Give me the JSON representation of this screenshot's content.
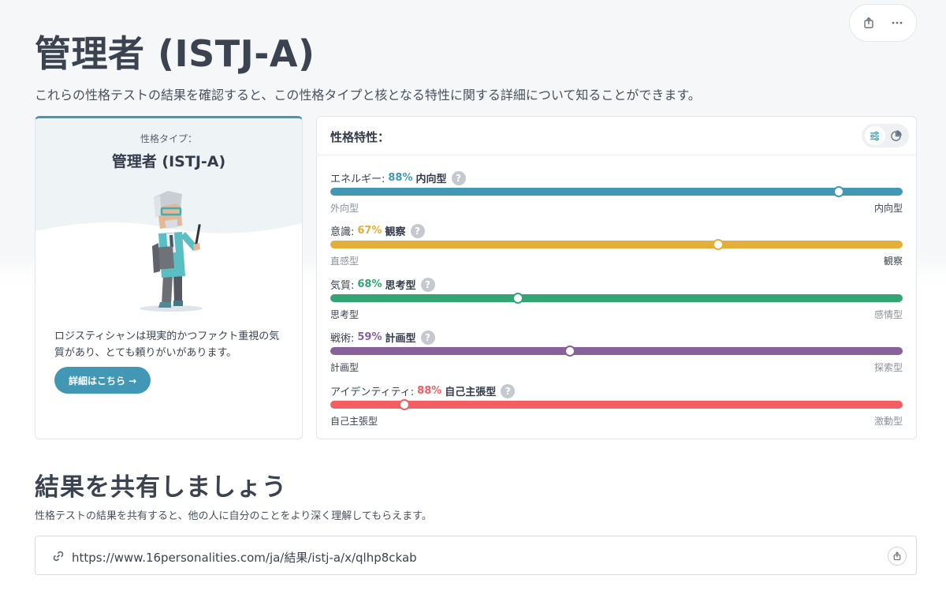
{
  "header": {
    "title": "管理者 (ISTJ-A)",
    "subtitle": "これらの性格テストの結果を確認すると、この性格タイプと核となる特性に関する詳細について知ることができます。"
  },
  "top_actions": {
    "share_icon": "share-icon",
    "more_icon": "more-icon"
  },
  "type_card": {
    "label": "性格タイプ：",
    "name": "管理者 (ISTJ-A)",
    "description": "ロジスティシャンは現実的かつファクト重視の気質があり、とても頼りがいがあります。",
    "button_label": "詳細はこちら →",
    "accent": "#4298b4"
  },
  "traits_card": {
    "heading": "性格特性：",
    "traits": [
      {
        "label": "エネルギー:",
        "percent": "88%",
        "side": "内向型",
        "left": "外向型",
        "right": "内向型",
        "color": "#4298b4",
        "position": 0.888,
        "active": "right"
      },
      {
        "label": "意識:",
        "percent": "67%",
        "side": "観察",
        "left": "直感型",
        "right": "観察",
        "color": "#e4ae3a",
        "position": 0.678,
        "active": "right"
      },
      {
        "label": "気質:",
        "percent": "68%",
        "side": "思考型",
        "left": "思考型",
        "right": "感情型",
        "color": "#33a474",
        "position": 0.328,
        "active": "left"
      },
      {
        "label": "戦術:",
        "percent": "59%",
        "side": "計画型",
        "left": "計画型",
        "right": "探索型",
        "color": "#88619a",
        "position": 0.419,
        "active": "left"
      },
      {
        "label": "アイデンティティ:",
        "percent": "88%",
        "side": "自己主張型",
        "left": "自己主張型",
        "right": "激動型",
        "color": "#f25e62",
        "position": 0.13,
        "active": "left"
      }
    ]
  },
  "share": {
    "title": "結果を共有しましょう",
    "subtitle": "性格テストの結果を共有すると、他の人に自分のことをより深く理解してもらえます。",
    "url": "https://www.16personalities.com/ja/結果/istj-a/x/qlhp8ckab"
  }
}
